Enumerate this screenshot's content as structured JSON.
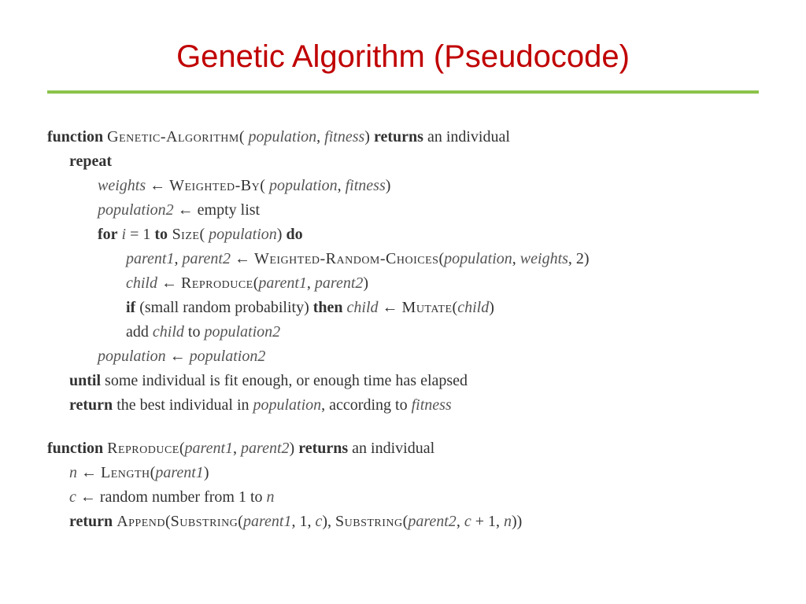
{
  "title": "Genetic Algorithm (Pseudocode)",
  "f1": {
    "kw_function": "function",
    "name": "Genetic-Algorithm",
    "args_open": "( ",
    "arg1": "population",
    "args_comma": ", ",
    "arg2": "fitness",
    "args_close": ") ",
    "kw_returns": "returns",
    "tail": " an individual",
    "kw_repeat": "repeat",
    "l1_lhs": "weights",
    "l1_arrow": " ← ",
    "l1_fn": "Weighted-By",
    "l1_open": "( ",
    "l1_a1": "population",
    "l1_comma": ", ",
    "l1_a2": "fitness",
    "l1_close": ")",
    "l2_lhs": "population2",
    "l2_arrow": " ← empty list",
    "kw_for": "for",
    "for_i": " i",
    "for_eq": " = 1 ",
    "kw_to": "to",
    "for_fn": " Size",
    "for_open": "( ",
    "for_arg": "population",
    "for_close": ") ",
    "kw_do": "do",
    "l3_lhs": "parent1",
    "l3_c": ", ",
    "l3_lhs2": "parent2",
    "l3_arrow": " ← ",
    "l3_fn": "Weighted-Random-Choices",
    "l3_open": "(",
    "l3_a1": "population",
    "l3_a2": "weights",
    "l3_a3": ", 2)",
    "l4_lhs": "child",
    "l4_arrow": " ← ",
    "l4_fn": "Reproduce",
    "l4_open": "(",
    "l4_a1": "parent1",
    "l4_a2": "parent2",
    "l4_close": ")",
    "kw_if": "if",
    "if_cond": " (small random probability) ",
    "kw_then": "then",
    "if_lhs": " child",
    "if_arrow": " ← ",
    "if_fn": "Mutate",
    "if_open": "(",
    "if_arg": "child",
    "if_close": ")",
    "l5_pre": "add ",
    "l5_a1": "child",
    "l5_mid": " to ",
    "l5_a2": "population2",
    "l6_lhs": "population",
    "l6_arrow": " ← ",
    "l6_rhs": "population2",
    "kw_until": "until",
    "until_tail": " some individual is fit enough, or enough time has elapsed",
    "kw_return": "return",
    "ret_pre": " the best individual in ",
    "ret_a1": "population",
    "ret_mid": ", according to ",
    "ret_a2": "fitness"
  },
  "f2": {
    "kw_function": "function",
    "name": "Reproduce",
    "args_open": "(",
    "arg1": "parent1",
    "args_comma": ", ",
    "arg2": "parent2",
    "args_close": ") ",
    "kw_returns": "returns",
    "tail": " an individual",
    "l1_lhs": "n",
    "l1_arrow": " ← ",
    "l1_fn": "Length",
    "l1_open": "(",
    "l1_arg": "parent1",
    "l1_close": ")",
    "l2_lhs": "c",
    "l2_arrow": " ← random number from 1 to ",
    "l2_n": "n",
    "kw_return": "return",
    "ret_sp": " ",
    "ret_fn1": "Append",
    "ret_open": "(",
    "ret_fn2": "Substring",
    "ret_s1_open": "(",
    "ret_s1_a1": "parent1",
    "ret_s1_mid": ", 1, ",
    "ret_s1_a2": "c",
    "ret_s1_close": "), ",
    "ret_fn3": "Substring",
    "ret_s2_open": "(",
    "ret_s2_a1": "parent2",
    "ret_s2_mid": ", ",
    "ret_s2_a2": "c",
    "ret_s2_plus": " + 1, ",
    "ret_s2_a3": "n",
    "ret_s2_close": "))"
  }
}
